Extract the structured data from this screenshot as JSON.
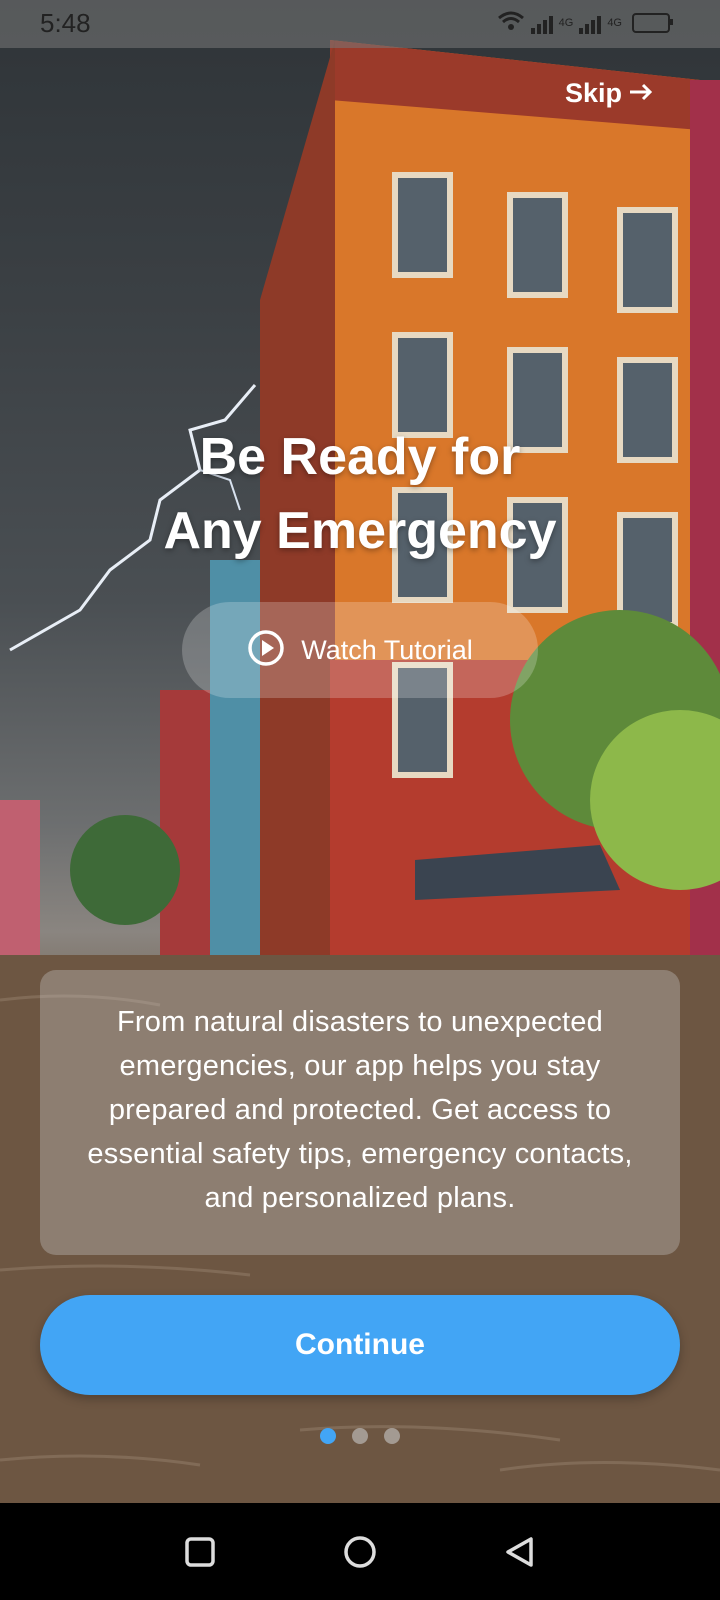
{
  "status_bar": {
    "time": "5:48",
    "net_label_1": "4G",
    "net_label_2": "4G"
  },
  "skip": {
    "label": "Skip",
    "icon": "arrow-right-icon"
  },
  "headline": {
    "line1": "Be Ready for",
    "line2": "Any Emergency"
  },
  "tutorial": {
    "label": "Watch Tutorial",
    "icon": "play-circle-icon"
  },
  "description": "From natural disasters to unexpected emergencies, our app helps you stay prepared and protected. Get access to essential safety tips, emergency contacts, and personalized plans.",
  "continue": {
    "label": "Continue"
  },
  "pager": {
    "total": 3,
    "active_index": 0
  },
  "colors": {
    "accent": "#42a5f5"
  },
  "nav": {
    "recent_icon": "square-icon",
    "home_icon": "circle-icon",
    "back_icon": "triangle-back-icon"
  }
}
